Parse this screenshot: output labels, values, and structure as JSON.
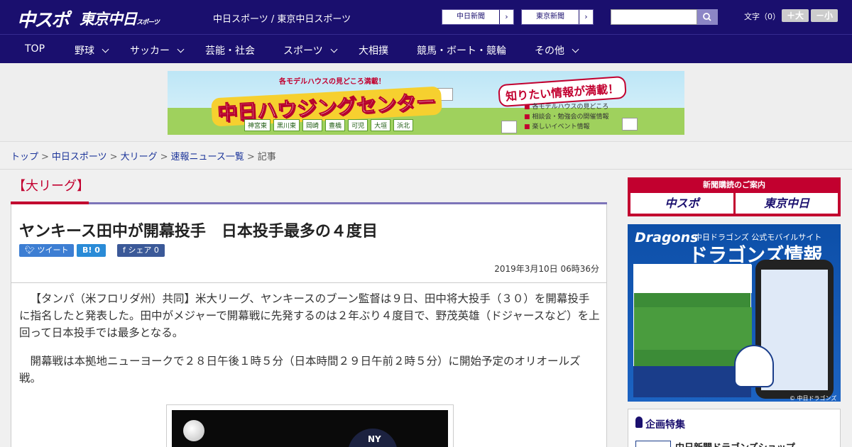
{
  "header": {
    "logo_main": "中スポ",
    "logo_tokyo": "東京中日",
    "logo_tokyo_suffix": "スポーツ",
    "site_links": "中日スポーツ / 東京中日スポーツ",
    "paper_buttons": [
      "中日新聞",
      "東京新聞"
    ],
    "font_size_label": "文字（0）",
    "font_larger": "＋大",
    "font_smaller": "－小"
  },
  "nav": {
    "items": [
      {
        "label": "TOP",
        "has_submenu": false
      },
      {
        "label": "野球",
        "has_submenu": true
      },
      {
        "label": "サッカー",
        "has_submenu": true
      },
      {
        "label": "芸能・社会",
        "has_submenu": false
      },
      {
        "label": "スポーツ",
        "has_submenu": true
      },
      {
        "label": "大相撲",
        "has_submenu": false
      },
      {
        "label": "競馬・ボート・競輪",
        "has_submenu": false
      },
      {
        "label": "その他",
        "has_submenu": true
      }
    ]
  },
  "banner": {
    "tagline": "各モデルハウスの見どころ満載！",
    "title": "中日ハウジングセンター",
    "bubble": "知りたい情報が満載！",
    "cities": [
      "神宮東",
      "黒川東",
      "岡崎",
      "豊橋",
      "可児",
      "大垣",
      "浜北"
    ],
    "info": [
      "各モデルハウスの見どころ",
      "相談会・勉強会の開催情報",
      "楽しいイベント情報"
    ]
  },
  "breadcrumb": {
    "items": [
      "トップ",
      "中日スポーツ",
      "大リーグ",
      "速報ニュース一覧"
    ],
    "current": "記事"
  },
  "article": {
    "section": "【大リーグ】",
    "headline": "ヤンキース田中が開幕投手　日本投手最多の４度目",
    "share": {
      "tweet": "ツイート",
      "hatena": "B! 0",
      "facebook": "シェア 0"
    },
    "date": "2019年3月10日 06時36分",
    "paragraphs": [
      "【タンパ（米フロリダ州）共同】米大リーグ、ヤンキースのブーン監督は９日、田中将大投手（３０）を開幕投手に指名したと発表した。田中がメジャーで開幕戦に先発するのは２年ぶり４度目で、野茂英雄（ドジャースなど）を上回って日本投手では最多となる。",
      "開幕戦は本拠地ニューヨークで２８日午後１時５分（日本時間２９日午前２時５分）に開始予定のオリオールズ戦。"
    ]
  },
  "sidebar": {
    "subscribe_title": "新聞購読のご案内",
    "subscribe_logos": [
      "中スポ",
      "東京中日"
    ],
    "dragons": {
      "logo": "Dragons",
      "small": "中日ドラゴンズ 公式モバイルサイト",
      "big": "ドラゴンズ情報",
      "copyright": "© 中日ドラゴンズ"
    },
    "feature_title": "企画特集",
    "feature_item": "中日新聞ドラゴンズショップ"
  }
}
